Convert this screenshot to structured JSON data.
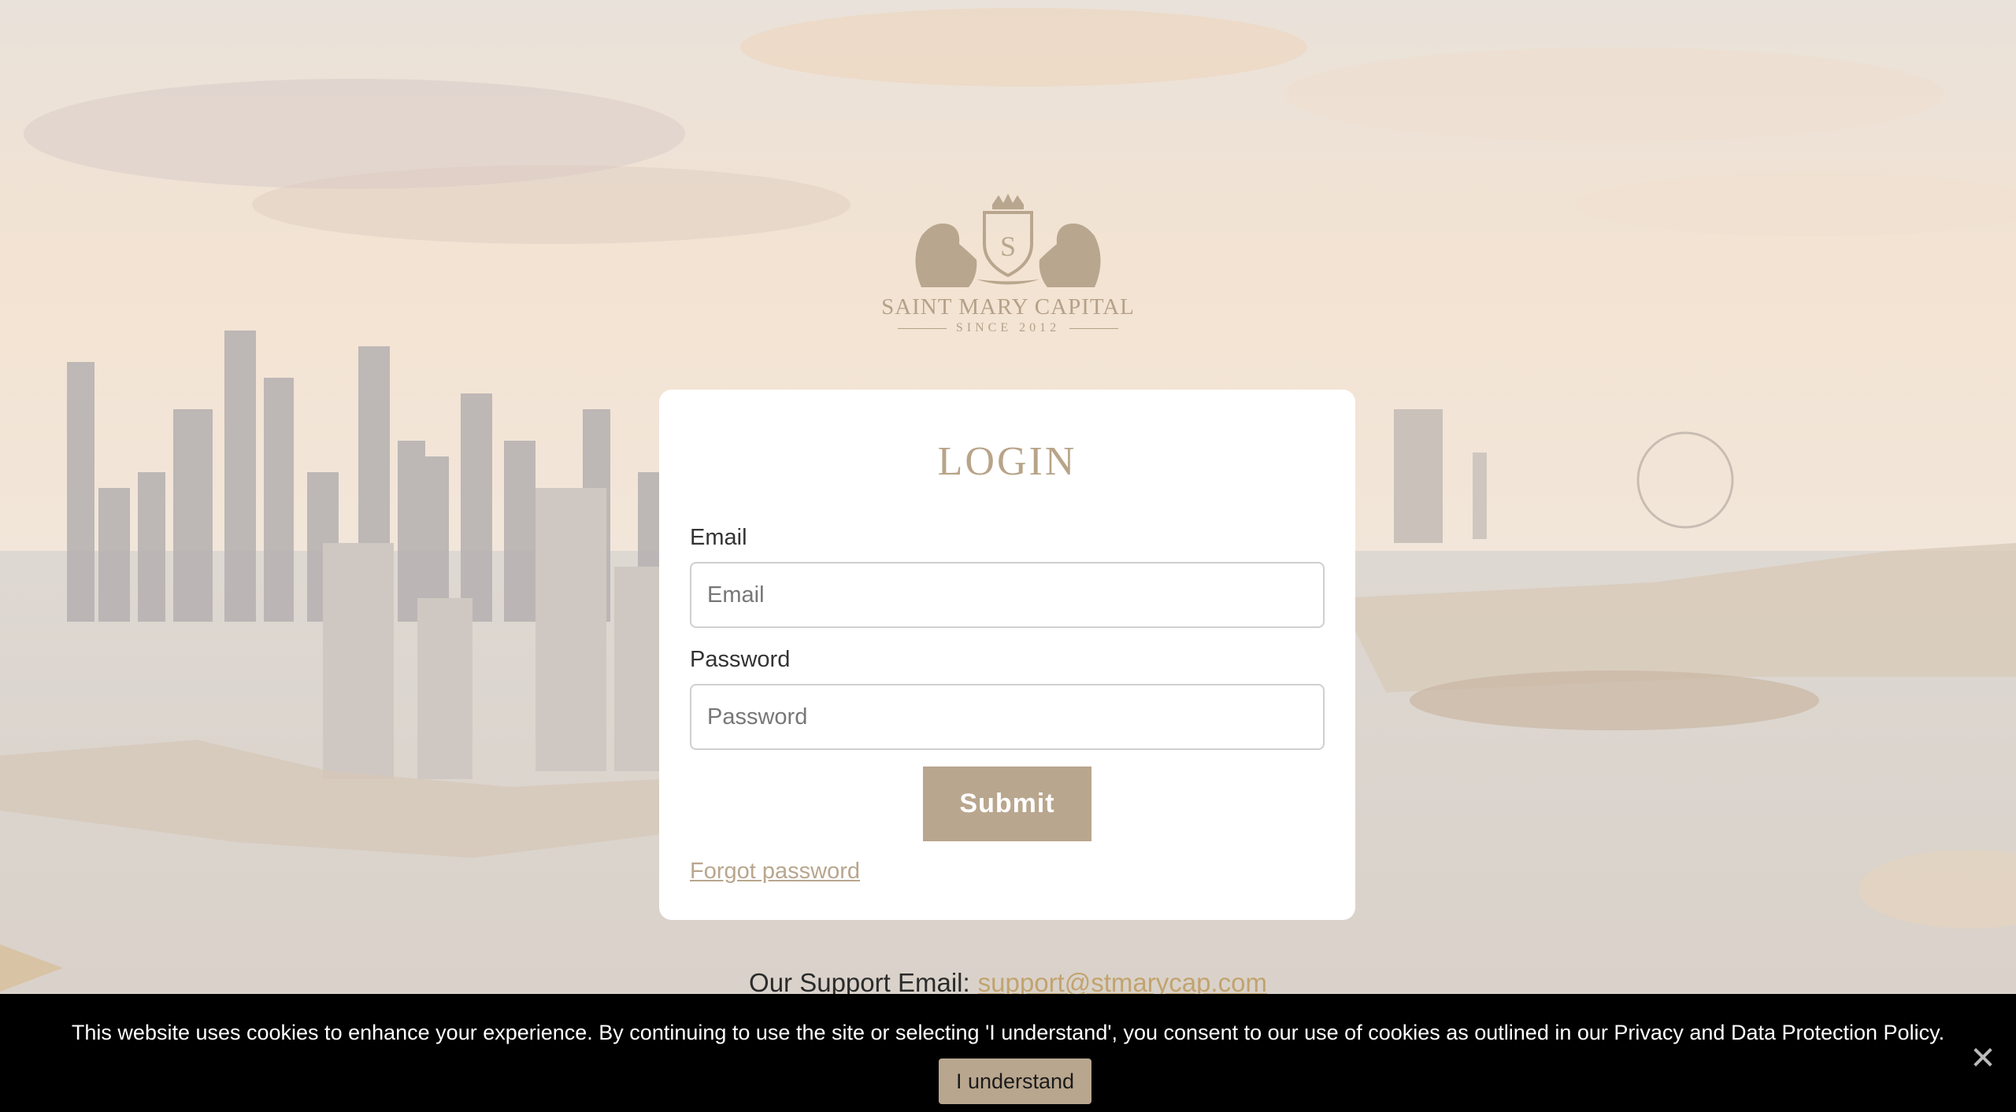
{
  "brand": {
    "name": "SAINT MARY CAPITAL",
    "since": "SINCE 2012",
    "logo_icon": "lion-crest-logo-icon"
  },
  "login": {
    "title": "LOGIN",
    "email_label": "Email",
    "email_placeholder": "Email",
    "email_value": "",
    "password_label": "Password",
    "password_placeholder": "Password",
    "password_value": "",
    "submit_label": "Submit",
    "forgot_label": "Forgot password"
  },
  "support": {
    "label": "Our Support Email:",
    "email": "support@stmarycap.com"
  },
  "cookie_banner": {
    "text": "This website uses cookies to enhance your experience. By continuing to use the site or selecting 'I understand', you consent to our use of cookies as outlined in our Privacy and Data Protection Policy.",
    "accept_label": "I understand",
    "close_icon": "close-icon"
  },
  "colors": {
    "accent": "#b9a68e",
    "banner_bg": "#000000",
    "link": "#c2a36f"
  }
}
